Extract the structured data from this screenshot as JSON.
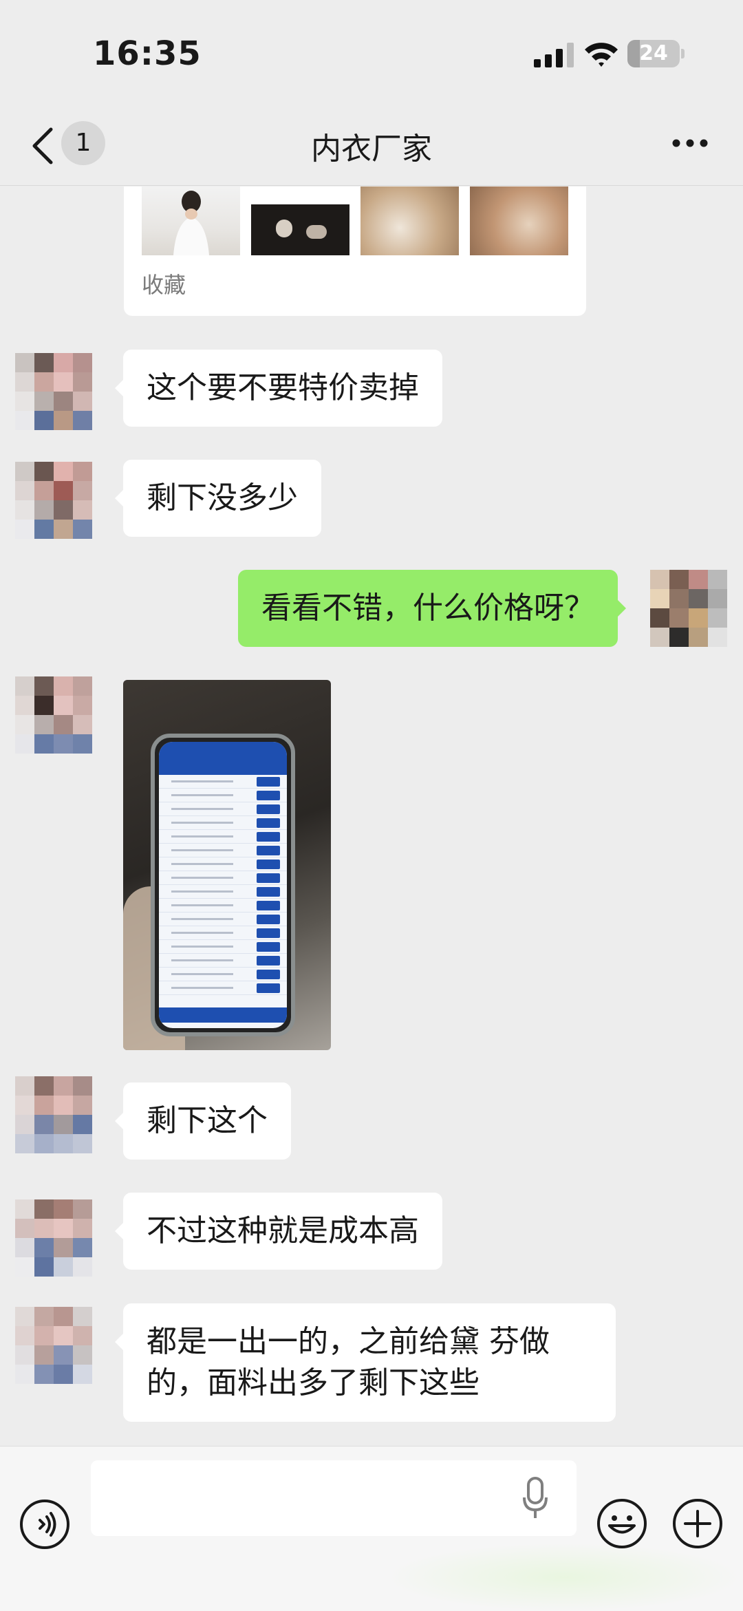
{
  "status_bar": {
    "time": "16:35",
    "battery_level": "24",
    "battery_fraction": 0.24
  },
  "nav": {
    "title": "内衣厂家",
    "unread_count": "1",
    "back_icon": "chevron-left-icon",
    "more_icon": "more-dots-icon"
  },
  "favorite_card": {
    "label": "收藏"
  },
  "messages": [
    {
      "side": "left",
      "text": "这个要不要特价卖掉"
    },
    {
      "side": "left",
      "text": "剩下没多少"
    },
    {
      "side": "right",
      "text": "看看不错，什么价格呀？"
    },
    {
      "side": "left",
      "type": "image"
    },
    {
      "side": "left",
      "text": "剩下这个"
    },
    {
      "side": "left",
      "text": "不过这种就是成本高"
    },
    {
      "side": "left",
      "text": "都是一出一的，之前给黛  芬做的，面料出多了剩下这些"
    }
  ],
  "input_bar": {
    "voice_icon": "voice-icon",
    "mic_icon": "microphone-icon",
    "emoji_icon": "emoji-icon",
    "plus_icon": "plus-icon",
    "placeholder": ""
  },
  "colors": {
    "background": "#ededed",
    "bubble_left": "#ffffff",
    "bubble_right": "#95ec69",
    "input_bar": "#f6f6f6"
  }
}
